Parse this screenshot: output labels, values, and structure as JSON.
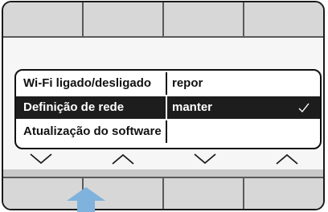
{
  "settings_menu": {
    "items": [
      {
        "name": "Wi-Fi ligado/desligado",
        "value": "repor",
        "selected": false
      },
      {
        "name": "Definição de rede",
        "value": "manter",
        "selected": true
      },
      {
        "name": "Atualização do software",
        "value": "",
        "selected": false
      }
    ]
  },
  "navigation": {
    "arrows": [
      "chevron-down-icon",
      "chevron-up-icon",
      "chevron-down-icon",
      "chevron-up-icon"
    ]
  },
  "colors": {
    "selection_bg": "#1d1d1d",
    "indicator_arrow": "#7fb2dc"
  }
}
